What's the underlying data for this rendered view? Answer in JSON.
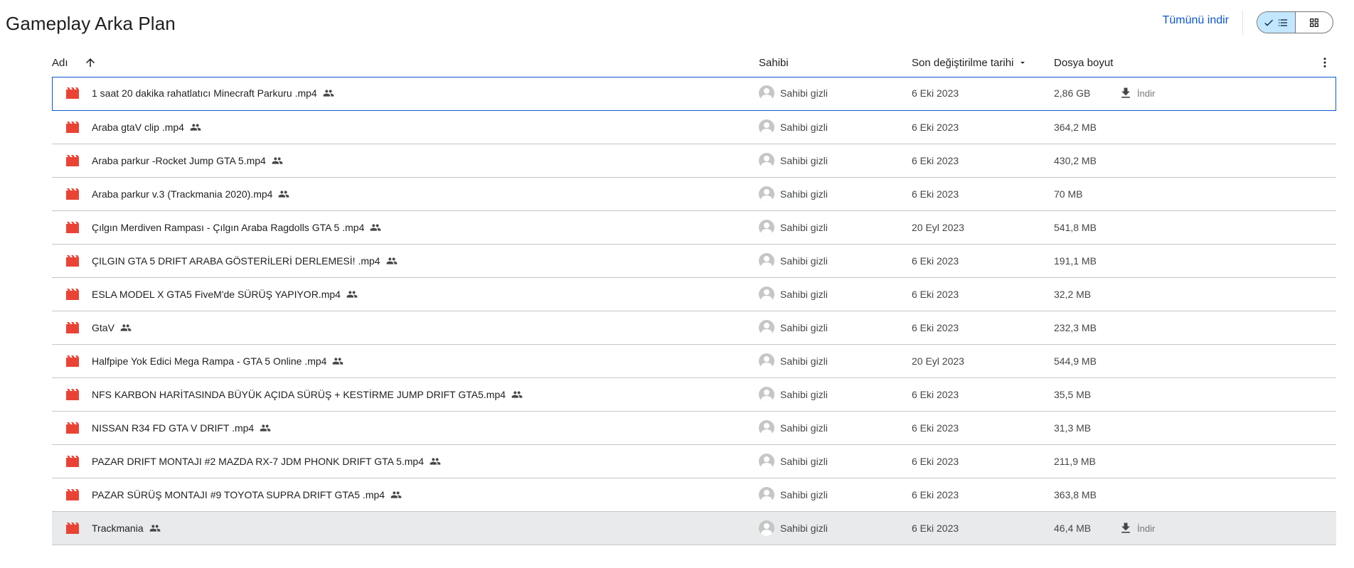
{
  "header": {
    "title": "Gameplay Arka Plan",
    "download_all": "Tümünü indir"
  },
  "columns": {
    "name": "Adı",
    "owner": "Sahibi",
    "modified": "Son değiştirilme tarihi",
    "size": "Dosya boyut"
  },
  "colors": {
    "accent": "#0b57d0",
    "file_icon": "#ea4335",
    "toggle_active": "#c2e7ff"
  },
  "rows": [
    {
      "name": "1 saat 20 dakika rahatlatıcı Minecraft Parkuru .mp4",
      "owner": "Sahibi gizli",
      "date": "6 Eki 2023",
      "size": "2,86 GB",
      "download": "İndir"
    },
    {
      "name": "Araba gtaV clip .mp4",
      "owner": "Sahibi gizli",
      "date": "6 Eki 2023",
      "size": "364,2 MB"
    },
    {
      "name": "Araba parkur -Rocket Jump GTA 5.mp4",
      "owner": "Sahibi gizli",
      "date": "6 Eki 2023",
      "size": "430,2 MB"
    },
    {
      "name": "Araba parkur v.3 (Trackmania 2020).mp4",
      "owner": "Sahibi gizli",
      "date": "6 Eki 2023",
      "size": "70 MB"
    },
    {
      "name": "Çılgın Merdiven Rampası - Çılgın Araba Ragdolls GTA 5 .mp4",
      "owner": "Sahibi gizli",
      "date": "20 Eyl 2023",
      "size": "541,8 MB"
    },
    {
      "name": "ÇILGIN GTA 5 DRIFT ARABA GÖSTERİLERİ DERLEMESİ! .mp4",
      "owner": "Sahibi gizli",
      "date": "6 Eki 2023",
      "size": "191,1 MB"
    },
    {
      "name": "ESLA MODEL X GTA5 FiveM'de SÜRÜŞ YAPIYOR.mp4",
      "owner": "Sahibi gizli",
      "date": "6 Eki 2023",
      "size": "32,2 MB"
    },
    {
      "name": "GtaV",
      "owner": "Sahibi gizli",
      "date": "6 Eki 2023",
      "size": "232,3 MB"
    },
    {
      "name": "Halfpipe Yok Edici Mega Rampa - GTA 5 Online .mp4",
      "owner": "Sahibi gizli",
      "date": "20 Eyl 2023",
      "size": "544,9 MB"
    },
    {
      "name": "NFS KARBON HARİTASINDA BÜYÜK AÇIDA SÜRÜŞ + KESTİRME JUMP DRIFT GTA5.mp4",
      "owner": "Sahibi gizli",
      "date": "6 Eki 2023",
      "size": "35,5 MB"
    },
    {
      "name": "NISSAN R34 FD GTA V DRIFT .mp4",
      "owner": "Sahibi gizli",
      "date": "6 Eki 2023",
      "size": "31,3 MB"
    },
    {
      "name": "PAZAR DRIFT MONTAJI #2 MAZDA RX-7 JDM PHONK DRIFT GTA 5.mp4",
      "owner": "Sahibi gizli",
      "date": "6 Eki 2023",
      "size": "211,9 MB"
    },
    {
      "name": "PAZAR SÜRÜŞ MONTAJI #9 TOYOTA SUPRA DRIFT GTA5 .mp4",
      "owner": "Sahibi gizli",
      "date": "6 Eki 2023",
      "size": "363,8 MB"
    },
    {
      "name": "Trackmania",
      "owner": "Sahibi gizli",
      "date": "6 Eki 2023",
      "size": "46,4 MB",
      "download": "İndir"
    }
  ]
}
